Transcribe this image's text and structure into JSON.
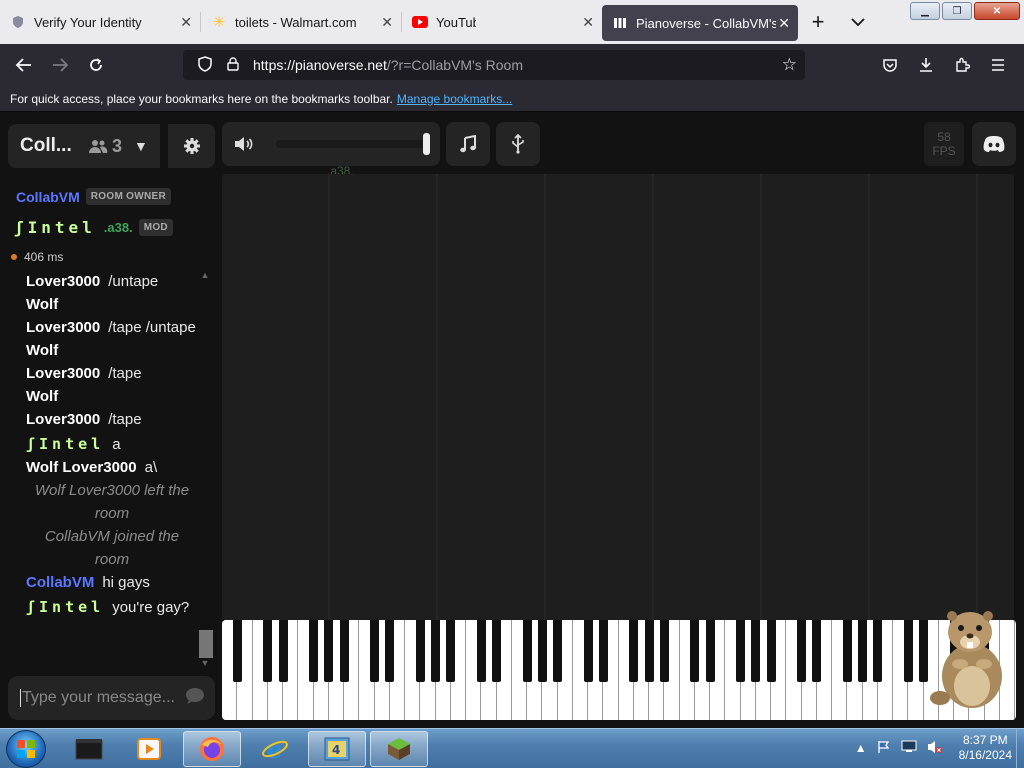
{
  "browser": {
    "tabs": [
      {
        "title": "Verify Your Identity",
        "icon": "shield-icon",
        "active": false
      },
      {
        "title": "toilets - Walmart.com",
        "icon": "walmart-spark-icon",
        "active": false
      },
      {
        "title": "YouTube",
        "icon": "youtube-icon",
        "active": false
      },
      {
        "title": "Pianoverse - CollabVM's Room",
        "icon": "pianoverse-icon",
        "active": true
      }
    ],
    "url_host": "https://pianoverse.net",
    "url_rest": "/?r=CollabVM's Room",
    "bookmark_hint": "For quick access, place your bookmarks here on the bookmarks toolbar.",
    "bookmark_link": "Manage bookmarks..."
  },
  "room": {
    "name": "Coll...",
    "user_count": "3",
    "owner_name": "CollabVM",
    "owner_badge": "ROOM OWNER",
    "mod_name": "ʃIntel",
    "mod_id": ".a38.",
    "mod_badge": "MOD",
    "ping": "406 ms"
  },
  "chat": {
    "messages": [
      {
        "user": "Lover3000",
        "text": "/untape",
        "style": "normal"
      },
      {
        "user": "Wolf",
        "text": "",
        "style": "normal"
      },
      {
        "user": "Lover3000",
        "text": "/tape /untape",
        "style": "normal"
      },
      {
        "user": "Wolf",
        "text": "",
        "style": "normal"
      },
      {
        "user": "Lover3000",
        "text": "/tape",
        "style": "normal"
      },
      {
        "user": "Wolf",
        "text": "",
        "style": "normal"
      },
      {
        "user": "Lover3000",
        "text": "/tape",
        "style": "normal"
      },
      {
        "user": "ʃIntel",
        "text": "a",
        "style": "mono"
      },
      {
        "user": "Wolf Lover3000",
        "text": "a\\",
        "style": "normal"
      },
      {
        "user": "",
        "text": "Wolf Lover3000 left the room",
        "style": "sys"
      },
      {
        "user": "",
        "text": "CollabVM joined the room",
        "style": "sys"
      },
      {
        "user": "CollabVM",
        "text": "hi gays",
        "style": "blue"
      },
      {
        "user": "ʃIntel",
        "text": "you're gay?",
        "style": "mono"
      }
    ],
    "input_placeholder": "Type your message..."
  },
  "toolbar": {
    "volume_level": 1.0,
    "ghost_id": ".a38.",
    "fps_value": "58",
    "fps_label": "FPS"
  },
  "taskbar": {
    "items": [
      "start-orb",
      "window-icon",
      "media-player-icon",
      "firefox-icon",
      "internet-explorer-icon",
      "winrar-icon",
      "minecraft-icon"
    ],
    "time": "8:37 PM",
    "date": "8/16/2024"
  },
  "colors": {
    "accent_blue": "#5b76ff",
    "mod_green": "#c8ff9a",
    "page_bg": "#121212"
  }
}
